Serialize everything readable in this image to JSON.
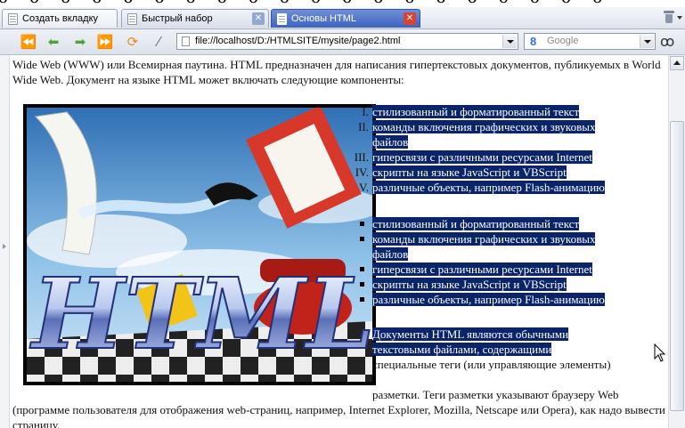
{
  "tabs": [
    {
      "label": "Создать вкладку"
    },
    {
      "label": "Быстрый набор"
    },
    {
      "label": "Основы HTML"
    }
  ],
  "toolbar": {
    "url": "file://localhost/D:/HTMLSITE/mysite/page2.html",
    "search_engine": "Google",
    "search_engine_logo": "8"
  },
  "page": {
    "intro": "Wide Web (WWW) или Всемирная паутина. HTML предназначен для написания гипертекстовых документов, публикуемых в World Wide Web. Документ на языке HTML может включать следующие компоненты:",
    "image_alt": "HTML",
    "ordered_markers": [
      "I.",
      "II.",
      "III.",
      "IV.",
      "V."
    ],
    "ordered_lines": [
      "стилизованный и форматированный текст",
      "команды включения графических и звуковых",
      "файлов",
      "гиперсвязи с различными ресурсами Internet",
      "скрипты на языке JavaScript и VBScript",
      "различные объекты, например Flash-анимацию"
    ],
    "bullet_lines": [
      "стилизованный и форматированный текст",
      "команды включения графических и звуковых",
      "файлов",
      "гиперсвязи с различными ресурсами Internet",
      "скрипты на языке JavaScript и VBScript",
      "различные объекты, например Flash-анимацию"
    ],
    "para2_lines": [
      "Документы HTML являются обычными",
      "текстовыми файлами, содержащими"
    ],
    "para2_rest": "специальные теги (или управляющие элементы)",
    "para3": "разметки. Теги разметки указывают браузеру Web (программе пользователя для отображения web-страниц, например, Internet Explorer, Mozilla, Netscape или Opera), как надо вывести страницу.",
    "top_strip": "ᴗ ᴖ ᴗ ᴖ ᴗ ᴖ ᴗ ᴖ ᴗ ᴖ ᴗ ᴖ ᴗ ᴖ ᴗ ᴖ ᴗ ᴖ ᴗ ᴖ ᴗ ᴖ ᴗ ᴖ ᴗ ᴖ ᴗ ᴖ ᴗ ᴖ ᴗ ᴖ ᴗ ᴖ ᴗ ᴖ ᴗ ᴖ ᴗ ᴖ"
  }
}
